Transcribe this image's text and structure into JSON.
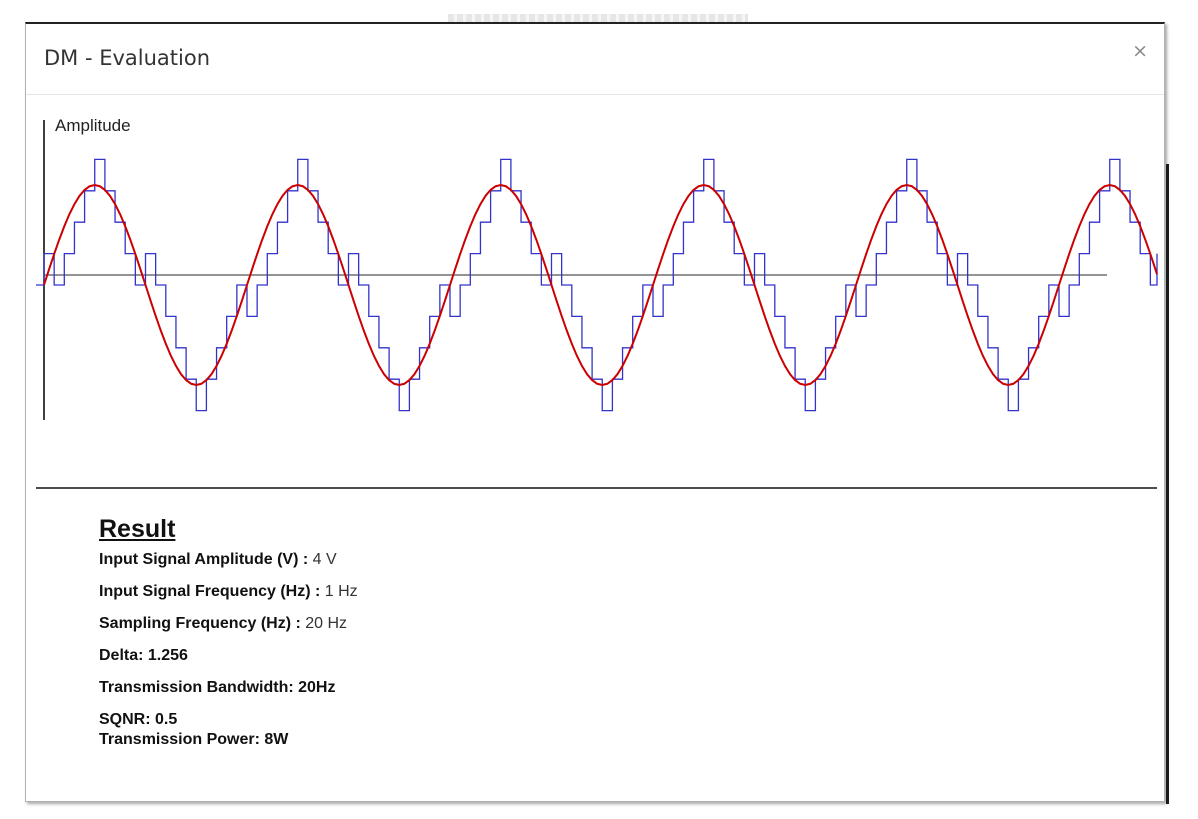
{
  "dialog": {
    "title": "DM - Evaluation",
    "close_label": "×"
  },
  "chart_data": {
    "type": "line",
    "ylabel": "Amplitude",
    "xlabel": "",
    "title": "",
    "amplitude": 4,
    "frequency_hz": 1,
    "sampling_frequency_hz": 20,
    "delta": 1.256,
    "cycles_shown": 5.5,
    "series": [
      {
        "values_note": "",
        "color": "#cc0000",
        "kind": "sine"
      },
      {
        "color": "#3333cc",
        "kind": "staircase"
      }
    ],
    "grid": false
  },
  "result": {
    "title": "Result",
    "rows": [
      {
        "key": "Input Signal Amplitude (V)",
        "sep": " : ",
        "value": "4 V"
      },
      {
        "key": "Input Signal Frequency (Hz)",
        "sep": " : ",
        "value": "1 Hz"
      },
      {
        "key": "Sampling Frequency (Hz)",
        "sep": " : ",
        "value": "20 Hz"
      }
    ],
    "delta_text": "Delta: 1.256",
    "bandwidth_text": "Transmission Bandwidth: 20Hz",
    "sqnr_text": "SQNR: 0.5",
    "power_text": "Transmission Power: 8W"
  },
  "colors": {
    "sine": "#cc0000",
    "staircase": "#3333cc",
    "axis": "#000000",
    "midline": "#555555"
  }
}
